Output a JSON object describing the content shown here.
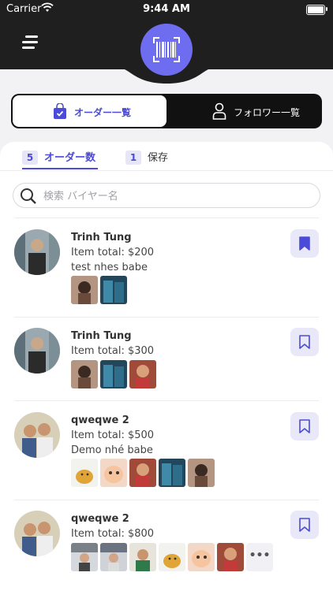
{
  "status": {
    "carrier": "Carrier",
    "time": "9:44 AM"
  },
  "segment": {
    "orders_label": "オーダー一覧",
    "followers_label": "フォロワー一覧"
  },
  "tabs": {
    "orders_count": "5",
    "orders_label": "オーダー数",
    "saved_count": "1",
    "saved_label": "保存"
  },
  "search": {
    "placeholder": "検索 バイヤー名",
    "value": ""
  },
  "orders": [
    {
      "name": "Trinh Tung",
      "total": "Item total: $200",
      "note": "test nhes babe",
      "saved": true,
      "thumbnails": 2
    },
    {
      "name": "Trinh Tung",
      "total": "Item total: $300",
      "note": "",
      "saved": false,
      "thumbnails": 3
    },
    {
      "name": "qweqwe 2",
      "total": "Item total: $500",
      "note": "Demo nhé babe",
      "saved": false,
      "thumbnails": 5
    },
    {
      "name": "qweqwe 2",
      "total": "Item total: $800",
      "note": "",
      "saved": false,
      "thumbnails": 6,
      "more": "•••"
    }
  ],
  "icons": {
    "menu": "hamburger-menu-icon",
    "scan": "barcode-scan-icon",
    "orders": "shopping-bag-check-icon",
    "followers": "user-icon",
    "search": "search-icon",
    "bookmark": "bookmark-icon"
  },
  "colors": {
    "accent": "#4c4ad8",
    "scan_button": "#6e6df0",
    "header": "#1f1f1f"
  }
}
